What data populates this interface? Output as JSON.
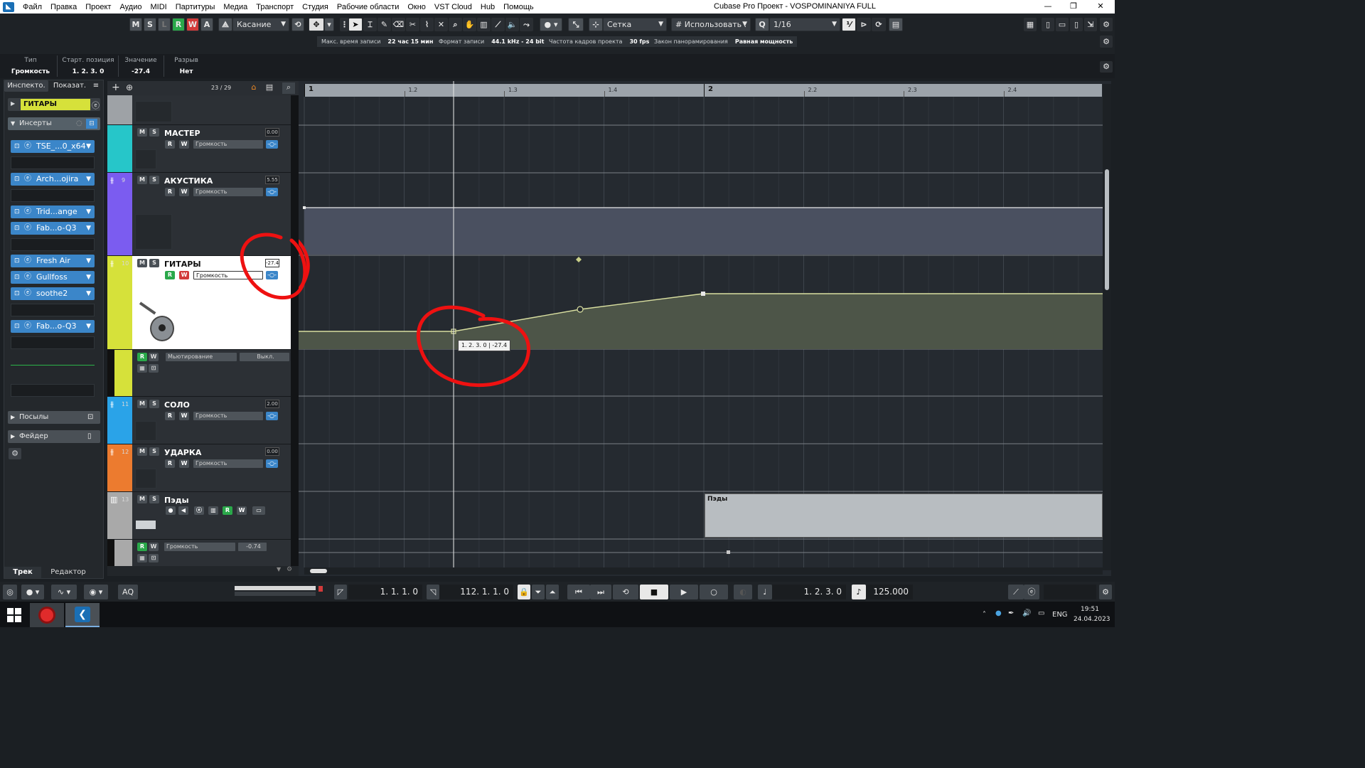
{
  "window": {
    "title": "Cubase Pro Проект - VOSPOMINANIYA FULL",
    "logo": "cubase-logo",
    "controls": {
      "minimize": "—",
      "restore": "❐",
      "close": "✕"
    }
  },
  "menu": [
    "Файл",
    "Правка",
    "Проект",
    "Аудио",
    "MIDI",
    "Партитуры",
    "Медиа",
    "Транспорт",
    "Студия",
    "Рабочие области",
    "Окно",
    "VST Cloud",
    "Hub",
    "Помощь"
  ],
  "toolbar": {
    "ms_buttons": [
      "M",
      "S",
      "L",
      "R",
      "W",
      "A"
    ],
    "automation_mode": "Касание",
    "snap_type": "Сетка",
    "snap_use": "Использовать .",
    "quantize": "1/16",
    "q_label": "Q"
  },
  "status_chips": [
    {
      "label": "Макс. время записи",
      "value": "22 час 15 мин"
    },
    {
      "label": "Формат записи",
      "value": "44.1 kHz - 24 bit"
    },
    {
      "label": "Частота кадров проекта",
      "value": "30 fps"
    },
    {
      "label": "Закон панорамирования",
      "value": "Равная мощность"
    }
  ],
  "infoline": [
    {
      "label": "Тип",
      "value": "Громкость"
    },
    {
      "label": "Старт. позиция",
      "value": "1. 2. 3.   0"
    },
    {
      "label": "Значение",
      "value": "-27.4"
    },
    {
      "label": "Разрыв",
      "value": "Нет"
    }
  ],
  "inspector": {
    "tabs": [
      "Инспекто.",
      "Показат."
    ],
    "track_name": "ГИТАРЫ",
    "inserts_label": "Инсерты",
    "inserts": [
      "TSE_...0_x64",
      "",
      "Arch...ojira",
      "",
      "Trid...ange",
      "Fab...o-Q3",
      "",
      "Fresh Air",
      "Gullfoss",
      "soothe2",
      "",
      "Fab...o-Q3",
      ""
    ],
    "sends_label": "Посылы",
    "fader_label": "Фейдер",
    "bottom_tabs": [
      "Трек",
      "Редактор"
    ]
  },
  "tracklist": {
    "counter": "23 / 29",
    "tracks": [
      {
        "name": "МАСТЕР",
        "num": "",
        "value": "0.00",
        "param": "Громкость",
        "color": "#26c6c9"
      },
      {
        "name": "АКУСТИКА",
        "num": "9",
        "value": "5.55",
        "param": "Громкость",
        "color": "#7b5cf0"
      },
      {
        "name": "ГИТАРЫ",
        "num": "10",
        "value": "-27.4",
        "param": "Громкость",
        "color": "#d6e13a"
      },
      {
        "name": "",
        "num": "",
        "value": "Выкл.",
        "param": "Мьютирование",
        "color": "#d6e13a"
      },
      {
        "name": "СОЛО",
        "num": "11",
        "value": "2.00",
        "param": "Громкость",
        "color": "#2aa3e8"
      },
      {
        "name": "УДАРКА",
        "num": "12",
        "value": "0.00",
        "param": "Громкость",
        "color": "#ec7b2f"
      },
      {
        "name": "Пэды",
        "num": "13",
        "value": "",
        "param": "",
        "color": "#a9a9a9"
      },
      {
        "name": "",
        "num": "",
        "value": "-0.74",
        "param": "Громкость",
        "color": "#a9a9a9"
      }
    ]
  },
  "ruler": [
    {
      "label": "1",
      "major": true
    },
    {
      "label": "1.2",
      "major": false
    },
    {
      "label": "1.3",
      "major": false
    },
    {
      "label": "1.4",
      "major": false
    },
    {
      "label": "2",
      "major": true
    },
    {
      "label": "2.2",
      "major": false
    },
    {
      "label": "2.3",
      "major": false
    },
    {
      "label": "2.4",
      "major": false
    }
  ],
  "automation_tooltip": "1. 2. 3.   0 | -27.4",
  "part_label": "Пэды",
  "transport": {
    "left_locator": "1.  1.  1.    0",
    "right_locator": "112.  1.  1.    0",
    "position": "1.  2.  3.    0",
    "tempo": "125.000",
    "aq": "AQ"
  },
  "taskbar": {
    "lang": "ENG",
    "time": "19:51",
    "date": "24.04.2023"
  }
}
